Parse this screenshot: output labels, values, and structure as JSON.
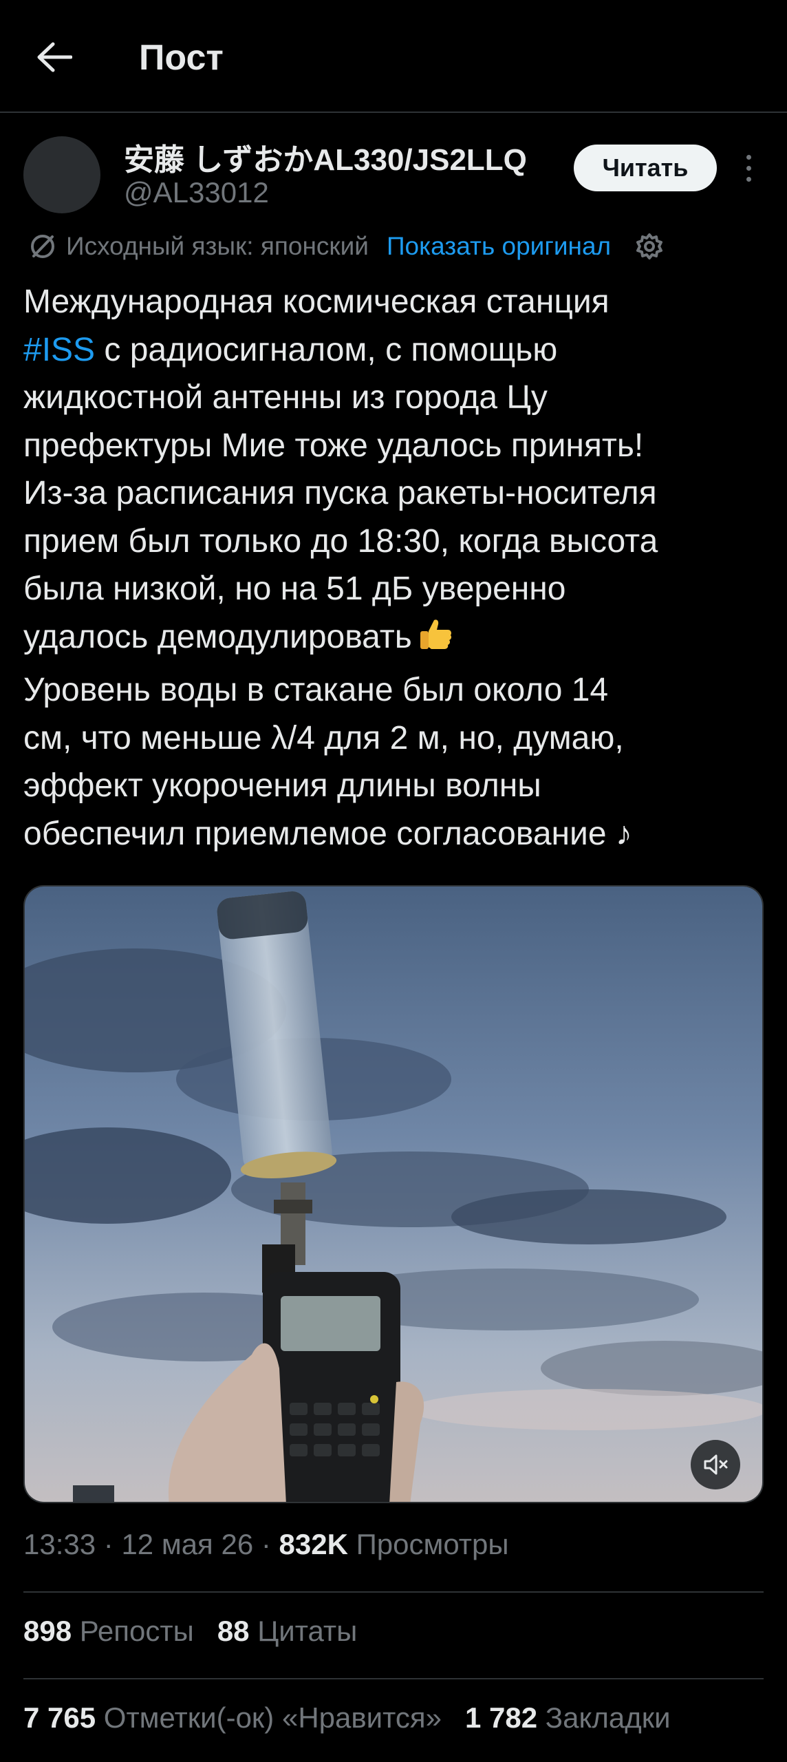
{
  "header": {
    "title": "Пост",
    "back_icon": "arrow-left-icon"
  },
  "author": {
    "name": "安藤 しずおかAL330/JS2LLQ",
    "handle": "@AL33012",
    "follow_label": "Читать"
  },
  "translation": {
    "label": "Исходный язык: японский",
    "show_original": "Показать оригинал"
  },
  "post": {
    "hashtag": "#ISS",
    "lines": [
      "Международная космическая станция",
      " с радиосигналом, с помощью",
      "жидкостной антенны из города Цу",
      "префектуры Мие тоже удалось принять!",
      "Из-за расписания пуска ракеты-носителя",
      "прием был только до 18:30, когда высота",
      "была низкой, но на 51 дБ уверенно",
      "удалось демодулировать",
      "Уровень воды в стакане был около 14",
      "см, что меньше λ/4 для 2 м, но, думаю,",
      "эффект укорочения длины волны",
      "обеспечил приемлемое согласование ♪"
    ],
    "emoji": "thumbs-up-emoji"
  },
  "media": {
    "type": "video",
    "mute_icon": "speaker-muted-icon"
  },
  "meta": {
    "time": "13:33",
    "date": "12 мая 26",
    "views_count": "832K",
    "views_label": "Просмотры"
  },
  "stats": {
    "reposts_count": "898",
    "reposts_label": "Репосты",
    "quotes_count": "88",
    "quotes_label": "Цитаты",
    "likes_count": "7 765",
    "likes_label": "Отметки(-ок) «Нравится»",
    "bookmarks_count": "1 782",
    "bookmarks_label": "Закладки"
  },
  "colors": {
    "background": "#000000",
    "text": "#e7e9ea",
    "secondary": "#71767b",
    "accent": "#1d9bf0",
    "divider": "#2f3336"
  }
}
